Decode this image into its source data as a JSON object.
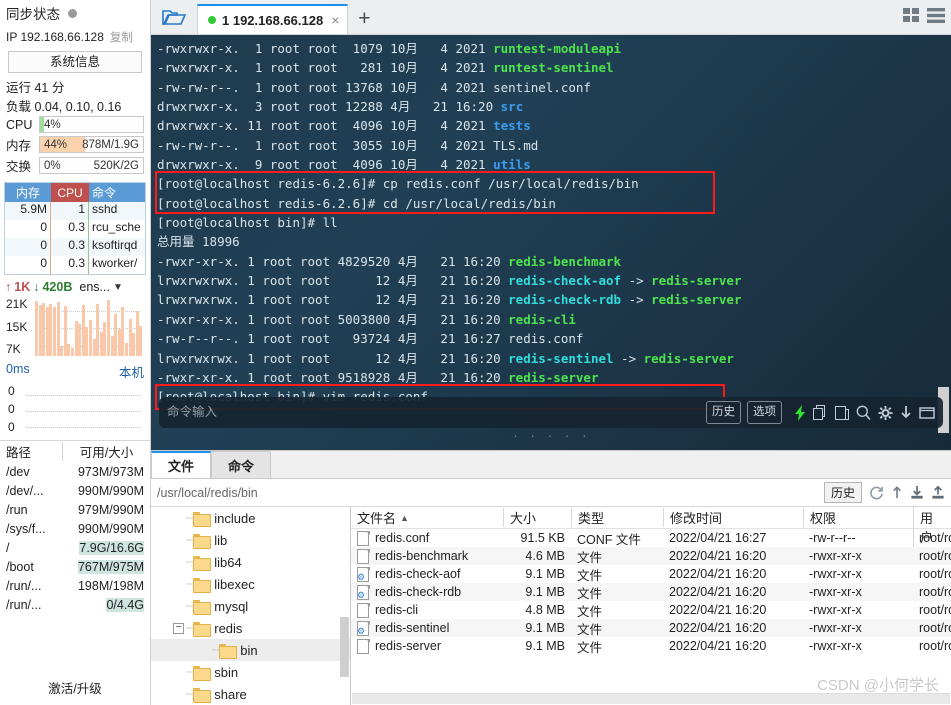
{
  "sidebar": {
    "sync_title": "同步状态",
    "sync_icon": "status-dot",
    "ip_label": "IP 192.168.66.128",
    "copy_label": "复制",
    "sysinfo_button": "系统信息",
    "uptime": "运行 41 分",
    "load": "负载 0.04, 0.10, 0.16",
    "meters": [
      {
        "name": "CPU",
        "label": "CPU",
        "percent": "4%",
        "detail": "",
        "fill_pct": 4,
        "color": "#9fe09f"
      },
      {
        "name": "memory",
        "label": "内存",
        "percent": "44%",
        "detail": "878M/1.9G",
        "fill_pct": 44,
        "color": "#fbd2ae"
      },
      {
        "name": "swap",
        "label": "交换",
        "percent": "0%",
        "detail": "520K/2G",
        "fill_pct": 0,
        "color": "#cfe4de"
      }
    ],
    "process_table": {
      "headers": [
        "内存",
        "CPU",
        "命令"
      ],
      "rows": [
        [
          "5.9M",
          "1",
          "sshd"
        ],
        [
          "0",
          "0.3",
          "rcu_sche"
        ],
        [
          "0",
          "0.3",
          "ksoftirqd"
        ],
        [
          "0",
          "0.3",
          "kworker/"
        ]
      ]
    },
    "network": {
      "up": "1K",
      "down": "420B",
      "interface": "ens...",
      "y_labels": [
        "21K",
        "15K",
        "7K"
      ],
      "bars": [
        95,
        88,
        92,
        85,
        90,
        84,
        93,
        18,
        86,
        20,
        14,
        60,
        55,
        88,
        50,
        62,
        30,
        90,
        42,
        58,
        96,
        35,
        72,
        46,
        84,
        22,
        64,
        40,
        78,
        52
      ]
    },
    "latency": {
      "label": "0ms",
      "right_label": "本机",
      "y_labels": [
        "0",
        "0",
        "0"
      ]
    },
    "disk": {
      "headers": [
        "路径",
        "可用/大小"
      ],
      "rows": [
        {
          "path": "/dev",
          "value": "973M/973M",
          "hl": false
        },
        {
          "path": "/dev/...",
          "value": "990M/990M",
          "hl": false
        },
        {
          "path": "/run",
          "value": "979M/990M",
          "hl": false
        },
        {
          "path": "/sys/f...",
          "value": "990M/990M",
          "hl": false
        },
        {
          "path": "/",
          "value": "7.9G/16.6G",
          "hl": true
        },
        {
          "path": "/boot",
          "value": "767M/975M",
          "hl": true
        },
        {
          "path": "/run/...",
          "value": "198M/198M",
          "hl": false
        },
        {
          "path": "/run/...",
          "value": "0/4.4G",
          "hl": true
        }
      ]
    },
    "activate": "激活/升级"
  },
  "tabbar": {
    "folder_icon": "open-folder-icon",
    "tab_label": "1 192.168.66.128",
    "tab_close": "×",
    "new_tab": "+",
    "win_icon_grid": "grid-view-icon",
    "win_icon_list": "list-view-icon"
  },
  "terminal": {
    "lines": [
      [
        {
          "t": "-rwxrwxr-x.  1 root root  1079 10月   4 2021 ",
          "c": "plain"
        },
        {
          "t": "runtest-moduleapi",
          "c": "green"
        }
      ],
      [
        {
          "t": "-rwxrwxr-x.  1 root root   281 10月   4 2021 ",
          "c": "plain"
        },
        {
          "t": "runtest-sentinel",
          "c": "green"
        }
      ],
      [
        {
          "t": "-rw-rw-r--.  1 root root 13768 10月   4 2021 sentinel.conf",
          "c": "plain"
        }
      ],
      [
        {
          "t": "drwxrwxr-x.  3 root root 12288 4月   21 16:20 ",
          "c": "plain"
        },
        {
          "t": "src",
          "c": "blue"
        }
      ],
      [
        {
          "t": "drwxrwxr-x. 11 root root  4096 10月   4 2021 ",
          "c": "plain"
        },
        {
          "t": "tests",
          "c": "blue"
        }
      ],
      [
        {
          "t": "-rw-rw-r--.  1 root root  3055 10月   4 2021 TLS.md",
          "c": "plain"
        }
      ],
      [
        {
          "t": "drwxrwxr-x.  9 root root  4096 10月   4 2021 ",
          "c": "plain"
        },
        {
          "t": "utils",
          "c": "blue"
        }
      ],
      [
        {
          "t": "[root@localhost redis-6.2.6]# cp redis.conf /usr/local/redis/bin",
          "c": "plain"
        }
      ],
      [
        {
          "t": "[root@localhost redis-6.2.6]# cd /usr/local/redis/bin",
          "c": "plain"
        }
      ],
      [
        {
          "t": "[root@localhost bin]# ll",
          "c": "plain"
        }
      ],
      [
        {
          "t": "总用量 18996",
          "c": "plain"
        }
      ],
      [
        {
          "t": "-rwxr-xr-x. 1 root root 4829520 4月   21 16:20 ",
          "c": "plain"
        },
        {
          "t": "redis-benchmark",
          "c": "green"
        }
      ],
      [
        {
          "t": "lrwxrwxrwx. 1 root root      12 4月   21 16:20 ",
          "c": "plain"
        },
        {
          "t": "redis-check-aof",
          "c": "cyan"
        },
        {
          "t": " -> ",
          "c": "plain"
        },
        {
          "t": "redis-server",
          "c": "green"
        }
      ],
      [
        {
          "t": "lrwxrwxrwx. 1 root root      12 4月   21 16:20 ",
          "c": "plain"
        },
        {
          "t": "redis-check-rdb",
          "c": "cyan"
        },
        {
          "t": " -> ",
          "c": "plain"
        },
        {
          "t": "redis-server",
          "c": "green"
        }
      ],
      [
        {
          "t": "-rwxr-xr-x. 1 root root 5003800 4月   21 16:20 ",
          "c": "plain"
        },
        {
          "t": "redis-cli",
          "c": "green"
        }
      ],
      [
        {
          "t": "-rw-r--r--. 1 root root   93724 4月   21 16:27 redis.conf",
          "c": "plain"
        }
      ],
      [
        {
          "t": "lrwxrwxrwx. 1 root root      12 4月   21 16:20 ",
          "c": "plain"
        },
        {
          "t": "redis-sentinel",
          "c": "cyan"
        },
        {
          "t": " -> ",
          "c": "plain"
        },
        {
          "t": "redis-server",
          "c": "green"
        }
      ],
      [
        {
          "t": "-rwxr-xr-x. 1 root root 9518928 4月   21 16:20 ",
          "c": "plain"
        },
        {
          "t": "redis-server",
          "c": "green"
        }
      ],
      [
        {
          "t": "[root@localhost bin]# vim redis.conf",
          "c": "plain"
        }
      ]
    ],
    "highlight_color": "#ff1a1a",
    "command_bar": {
      "placeholder": "命令输入",
      "history_label": "历史",
      "options_label": "选项",
      "icons": [
        "lightning-icon",
        "copy-icon",
        "paste-icon",
        "search-icon",
        "gear-icon",
        "download-icon",
        "window-icon"
      ]
    }
  },
  "filemanager": {
    "tabs": [
      {
        "label": "文件",
        "active": true
      },
      {
        "label": "命令",
        "active": false
      }
    ],
    "path": "/usr/local/redis/bin",
    "history_label": "历史",
    "path_icons": [
      "refresh-icon",
      "up-icon",
      "download-icon",
      "upload-icon"
    ],
    "tree": [
      {
        "label": "include",
        "depth": 1,
        "expander": "",
        "selected": false
      },
      {
        "label": "lib",
        "depth": 1,
        "expander": "",
        "selected": false
      },
      {
        "label": "lib64",
        "depth": 1,
        "expander": "",
        "selected": false
      },
      {
        "label": "libexec",
        "depth": 1,
        "expander": "",
        "selected": false
      },
      {
        "label": "mysql",
        "depth": 1,
        "expander": "",
        "selected": false
      },
      {
        "label": "redis",
        "depth": 1,
        "expander": "−",
        "selected": false
      },
      {
        "label": "bin",
        "depth": 2,
        "expander": "",
        "selected": true
      },
      {
        "label": "sbin",
        "depth": 1,
        "expander": "",
        "selected": false
      },
      {
        "label": "share",
        "depth": 1,
        "expander": "",
        "selected": false
      }
    ],
    "columns": [
      "文件名",
      "大小",
      "类型",
      "修改时间",
      "权限",
      "用户/用户组"
    ],
    "sort_indicator": "▲",
    "files": [
      {
        "name": "redis.conf",
        "icon": "file-icon",
        "size": "91.5 KB",
        "type": "CONF 文件",
        "mtime": "2022/04/21 16:27",
        "perm": "-rw-r--r--",
        "owner": "root/root"
      },
      {
        "name": "redis-benchmark",
        "icon": "file-icon",
        "size": "4.6 MB",
        "type": "文件",
        "mtime": "2022/04/21 16:20",
        "perm": "-rwxr-xr-x",
        "owner": "root/root"
      },
      {
        "name": "redis-check-aof",
        "icon": "link-file-icon",
        "size": "9.1 MB",
        "type": "文件",
        "mtime": "2022/04/21 16:20",
        "perm": "-rwxr-xr-x",
        "owner": "root/root"
      },
      {
        "name": "redis-check-rdb",
        "icon": "link-file-icon",
        "size": "9.1 MB",
        "type": "文件",
        "mtime": "2022/04/21 16:20",
        "perm": "-rwxr-xr-x",
        "owner": "root/root"
      },
      {
        "name": "redis-cli",
        "icon": "file-icon",
        "size": "4.8 MB",
        "type": "文件",
        "mtime": "2022/04/21 16:20",
        "perm": "-rwxr-xr-x",
        "owner": "root/root"
      },
      {
        "name": "redis-sentinel",
        "icon": "link-file-icon",
        "size": "9.1 MB",
        "type": "文件",
        "mtime": "2022/04/21 16:20",
        "perm": "-rwxr-xr-x",
        "owner": "root/root"
      },
      {
        "name": "redis-server",
        "icon": "file-icon",
        "size": "9.1 MB",
        "type": "文件",
        "mtime": "2022/04/21 16:20",
        "perm": "-rwxr-xr-x",
        "owner": "root/root"
      }
    ]
  },
  "watermark": "CSDN @小何学长"
}
